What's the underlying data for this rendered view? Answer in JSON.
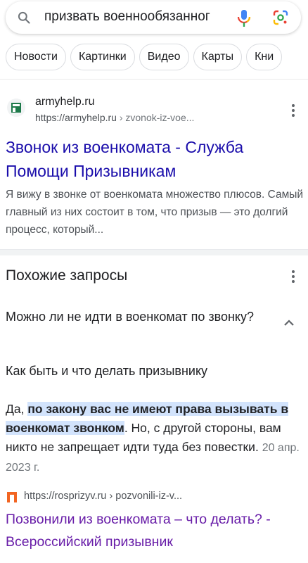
{
  "search": {
    "query": "призвать военнообязанног"
  },
  "chips": [
    "Новости",
    "Картинки",
    "Видео",
    "Карты",
    "Кни"
  ],
  "result1": {
    "site_name": "armyhelp.ru",
    "url_base": "https://armyhelp.ru",
    "url_path": " › zvonok-iz-voe...",
    "title": "Звонок из военкомата - Служба Помощи Призывникам",
    "snippet": "Я вижу в звонке от военкомата множество плюсов. Самый главный из них состоит в том, что призыв — это долгий процесс, который..."
  },
  "related": {
    "heading": "Похожие запросы",
    "question": "Можно ли не идти в военкомат по звонку?",
    "subheading": "Как быть и что делать призывнику",
    "answer_pre": "Да, ",
    "answer_highlight": "по закону вас не имеют права вызывать в военкомат звонком",
    "answer_post": ". Но, с другой стороны, вам никто не запрещает идти туда без повестки.",
    "answer_date": "20 апр. 2023 г."
  },
  "result2": {
    "url": "https://rosprizyv.ru › pozvonili-iz-v...",
    "title": "Позвонили из военкомата – что делать? - Всероссийский призывник"
  },
  "colors": {
    "link": "#1a0dab",
    "visited": "#681da8",
    "highlight": "#d2e3fc"
  }
}
